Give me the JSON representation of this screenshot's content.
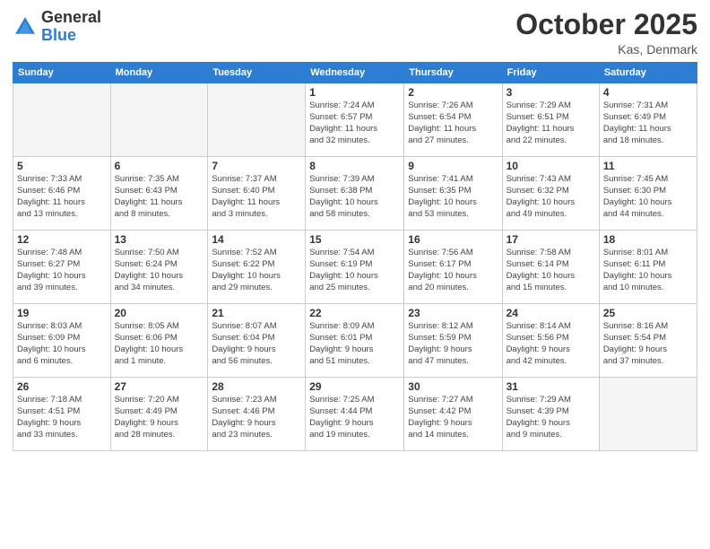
{
  "header": {
    "logo_general": "General",
    "logo_blue": "Blue",
    "month": "October 2025",
    "location": "Kas, Denmark"
  },
  "weekdays": [
    "Sunday",
    "Monday",
    "Tuesday",
    "Wednesday",
    "Thursday",
    "Friday",
    "Saturday"
  ],
  "weeks": [
    [
      {
        "day": "",
        "info": ""
      },
      {
        "day": "",
        "info": ""
      },
      {
        "day": "",
        "info": ""
      },
      {
        "day": "1",
        "info": "Sunrise: 7:24 AM\nSunset: 6:57 PM\nDaylight: 11 hours\nand 32 minutes."
      },
      {
        "day": "2",
        "info": "Sunrise: 7:26 AM\nSunset: 6:54 PM\nDaylight: 11 hours\nand 27 minutes."
      },
      {
        "day": "3",
        "info": "Sunrise: 7:29 AM\nSunset: 6:51 PM\nDaylight: 11 hours\nand 22 minutes."
      },
      {
        "day": "4",
        "info": "Sunrise: 7:31 AM\nSunset: 6:49 PM\nDaylight: 11 hours\nand 18 minutes."
      }
    ],
    [
      {
        "day": "5",
        "info": "Sunrise: 7:33 AM\nSunset: 6:46 PM\nDaylight: 11 hours\nand 13 minutes."
      },
      {
        "day": "6",
        "info": "Sunrise: 7:35 AM\nSunset: 6:43 PM\nDaylight: 11 hours\nand 8 minutes."
      },
      {
        "day": "7",
        "info": "Sunrise: 7:37 AM\nSunset: 6:40 PM\nDaylight: 11 hours\nand 3 minutes."
      },
      {
        "day": "8",
        "info": "Sunrise: 7:39 AM\nSunset: 6:38 PM\nDaylight: 10 hours\nand 58 minutes."
      },
      {
        "day": "9",
        "info": "Sunrise: 7:41 AM\nSunset: 6:35 PM\nDaylight: 10 hours\nand 53 minutes."
      },
      {
        "day": "10",
        "info": "Sunrise: 7:43 AM\nSunset: 6:32 PM\nDaylight: 10 hours\nand 49 minutes."
      },
      {
        "day": "11",
        "info": "Sunrise: 7:45 AM\nSunset: 6:30 PM\nDaylight: 10 hours\nand 44 minutes."
      }
    ],
    [
      {
        "day": "12",
        "info": "Sunrise: 7:48 AM\nSunset: 6:27 PM\nDaylight: 10 hours\nand 39 minutes."
      },
      {
        "day": "13",
        "info": "Sunrise: 7:50 AM\nSunset: 6:24 PM\nDaylight: 10 hours\nand 34 minutes."
      },
      {
        "day": "14",
        "info": "Sunrise: 7:52 AM\nSunset: 6:22 PM\nDaylight: 10 hours\nand 29 minutes."
      },
      {
        "day": "15",
        "info": "Sunrise: 7:54 AM\nSunset: 6:19 PM\nDaylight: 10 hours\nand 25 minutes."
      },
      {
        "day": "16",
        "info": "Sunrise: 7:56 AM\nSunset: 6:17 PM\nDaylight: 10 hours\nand 20 minutes."
      },
      {
        "day": "17",
        "info": "Sunrise: 7:58 AM\nSunset: 6:14 PM\nDaylight: 10 hours\nand 15 minutes."
      },
      {
        "day": "18",
        "info": "Sunrise: 8:01 AM\nSunset: 6:11 PM\nDaylight: 10 hours\nand 10 minutes."
      }
    ],
    [
      {
        "day": "19",
        "info": "Sunrise: 8:03 AM\nSunset: 6:09 PM\nDaylight: 10 hours\nand 6 minutes."
      },
      {
        "day": "20",
        "info": "Sunrise: 8:05 AM\nSunset: 6:06 PM\nDaylight: 10 hours\nand 1 minute."
      },
      {
        "day": "21",
        "info": "Sunrise: 8:07 AM\nSunset: 6:04 PM\nDaylight: 9 hours\nand 56 minutes."
      },
      {
        "day": "22",
        "info": "Sunrise: 8:09 AM\nSunset: 6:01 PM\nDaylight: 9 hours\nand 51 minutes."
      },
      {
        "day": "23",
        "info": "Sunrise: 8:12 AM\nSunset: 5:59 PM\nDaylight: 9 hours\nand 47 minutes."
      },
      {
        "day": "24",
        "info": "Sunrise: 8:14 AM\nSunset: 5:56 PM\nDaylight: 9 hours\nand 42 minutes."
      },
      {
        "day": "25",
        "info": "Sunrise: 8:16 AM\nSunset: 5:54 PM\nDaylight: 9 hours\nand 37 minutes."
      }
    ],
    [
      {
        "day": "26",
        "info": "Sunrise: 7:18 AM\nSunset: 4:51 PM\nDaylight: 9 hours\nand 33 minutes."
      },
      {
        "day": "27",
        "info": "Sunrise: 7:20 AM\nSunset: 4:49 PM\nDaylight: 9 hours\nand 28 minutes."
      },
      {
        "day": "28",
        "info": "Sunrise: 7:23 AM\nSunset: 4:46 PM\nDaylight: 9 hours\nand 23 minutes."
      },
      {
        "day": "29",
        "info": "Sunrise: 7:25 AM\nSunset: 4:44 PM\nDaylight: 9 hours\nand 19 minutes."
      },
      {
        "day": "30",
        "info": "Sunrise: 7:27 AM\nSunset: 4:42 PM\nDaylight: 9 hours\nand 14 minutes."
      },
      {
        "day": "31",
        "info": "Sunrise: 7:29 AM\nSunset: 4:39 PM\nDaylight: 9 hours\nand 9 minutes."
      },
      {
        "day": "",
        "info": ""
      }
    ]
  ]
}
